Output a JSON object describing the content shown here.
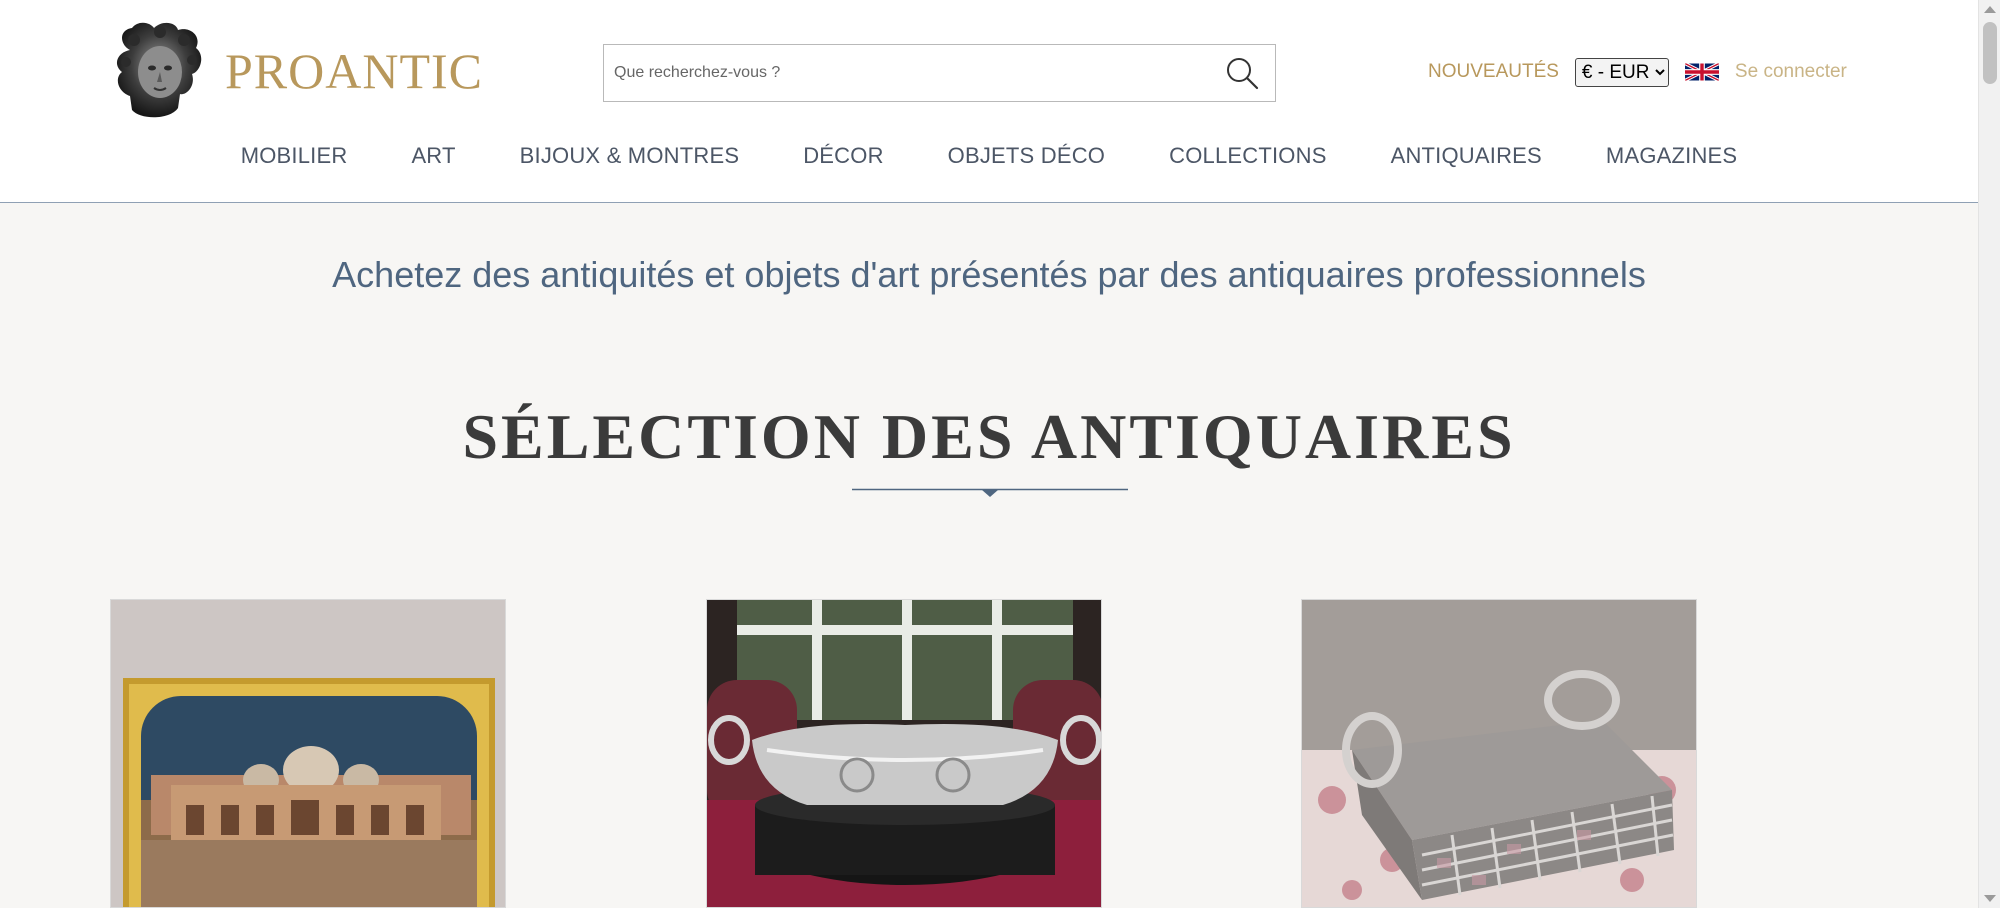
{
  "brand": {
    "name": "PROANTIC",
    "accent_color": "#b8985c"
  },
  "search": {
    "placeholder": "Que recherchez-vous ?",
    "value": "",
    "icon": "search-icon"
  },
  "topbar": {
    "new_label": "NOUVEAUTÉS",
    "currency": {
      "selected": "€ - EUR"
    },
    "language_icon": "uk-flag-icon",
    "login_label": "Se connecter"
  },
  "nav": {
    "items": [
      {
        "label": "MOBILIER"
      },
      {
        "label": "ART"
      },
      {
        "label": "BIJOUX & MONTRES"
      },
      {
        "label": "DÉCOR"
      },
      {
        "label": "OBJETS DÉCO"
      },
      {
        "label": "COLLECTIONS"
      },
      {
        "label": "ANTIQUAIRES"
      },
      {
        "label": "MAGAZINES"
      }
    ]
  },
  "main": {
    "tagline": "Achetez des antiquités et objets d'art présentés par des antiquaires professionnels",
    "section_title": "SÉLECTION DES ANTIQUAIRES"
  }
}
